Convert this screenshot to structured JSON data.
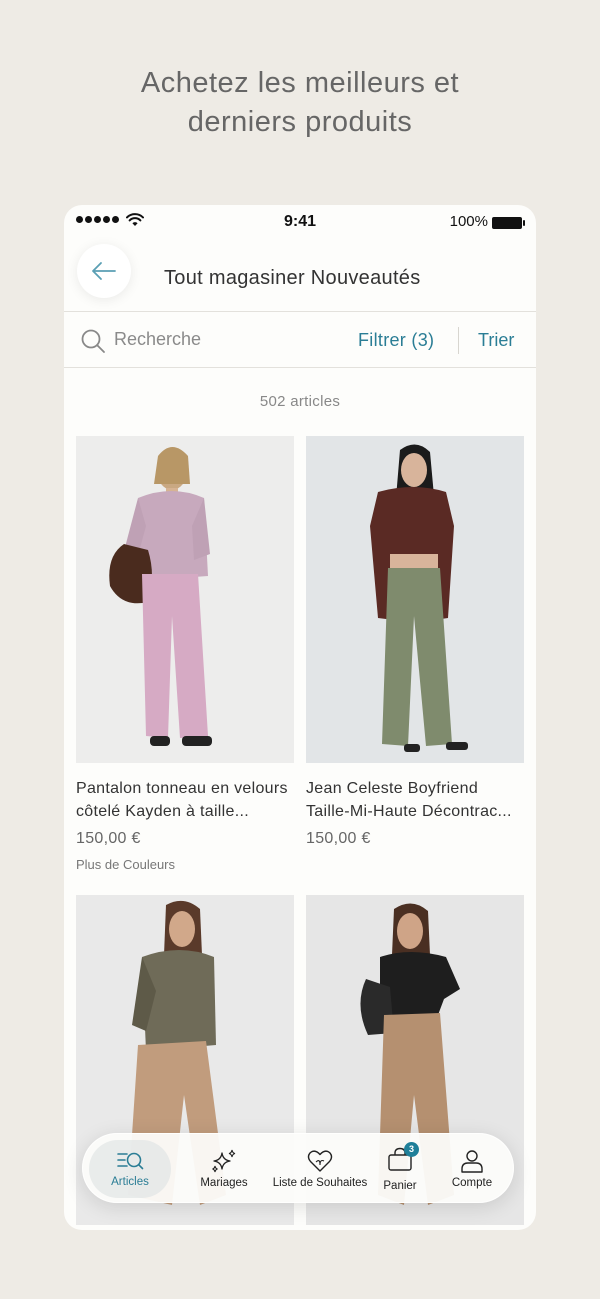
{
  "promo": {
    "line1": "Achetez les meilleurs et",
    "line2": "derniers produits"
  },
  "status_bar": {
    "time": "9:41",
    "battery": "100%"
  },
  "header": {
    "title": "Tout magasiner Nouveautés"
  },
  "search": {
    "placeholder": "Recherche",
    "filter_label": "Filtrer (3)",
    "sort_label": "Trier"
  },
  "results": {
    "count": "502 articles"
  },
  "products": [
    {
      "name": "Pantalon tonneau en velours côtelé Kayden à taille...",
      "price": "150,00 €",
      "more": "Plus de Couleurs"
    },
    {
      "name": "Jean Celeste Boyfriend Taille-Mi-Haute Décontrac...",
      "price": "150,00 €"
    }
  ],
  "nav": {
    "active": "Articles",
    "items": [
      {
        "label": "Articles",
        "icon": "articles-search-icon"
      },
      {
        "label": "Mariages",
        "icon": "sparkles-icon"
      },
      {
        "label": "Liste de Souhaites",
        "icon": "heart-icon"
      },
      {
        "label": "Panier",
        "icon": "bag-icon",
        "badge": "3"
      },
      {
        "label": "Compte",
        "icon": "user-icon"
      }
    ]
  },
  "colors": {
    "accent": "#2a7d95",
    "background": "#eeebe5",
    "surface": "#fdfdfb"
  }
}
